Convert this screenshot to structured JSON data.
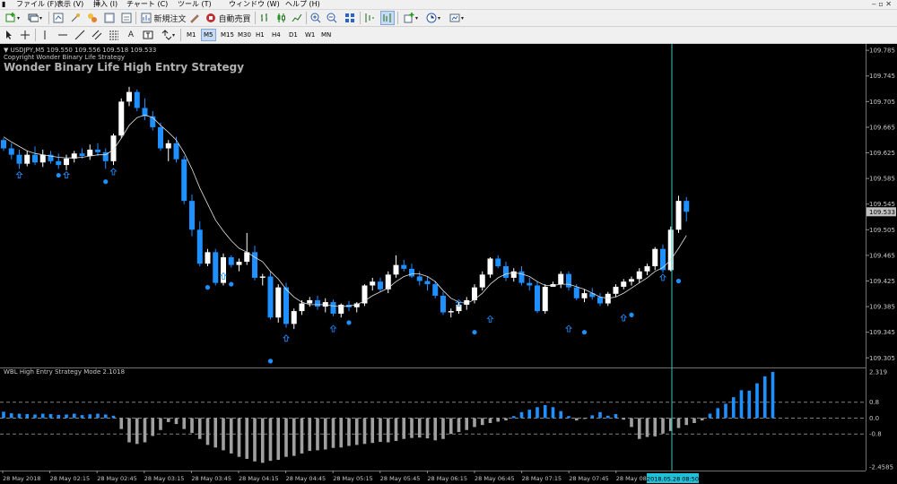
{
  "menu": {
    "items": [
      "ファイル (F)",
      "表示 (V)",
      "挿入 (I)",
      "チャート (C)",
      "ツール (T)",
      "ウィンドウ (W)",
      "ヘルプ (H)"
    ]
  },
  "toolbar": {
    "new_order_label": "新規注文",
    "auto_trade_label": "自動売買"
  },
  "timeframes": [
    "M1",
    "M5",
    "M15",
    "M30",
    "H1",
    "H4",
    "D1",
    "W1",
    "MN"
  ],
  "active_timeframe": "M5",
  "chart": {
    "symbol_line": "▼ USDJPY,M5  109.550 109.556 109.518 109.533",
    "copyright": "Copyright Wonder Binary Life Strategy",
    "strategy_title": "Wonder Binary Life High Entry Strategy",
    "current_price": "109.533",
    "crosshair_time": "2018.05.28 08:50",
    "price_ticks": [
      "109.785",
      "109.745",
      "109.705",
      "109.665",
      "109.625",
      "109.585",
      "109.545",
      "109.505",
      "109.465",
      "109.425",
      "109.385",
      "109.345",
      "109.305"
    ],
    "time_ticks": [
      "28 May 2018",
      "28 May 02:15",
      "28 May 02:45",
      "28 May 03:15",
      "28 May 03:45",
      "28 May 04:15",
      "28 May 04:45",
      "28 May 05:15",
      "28 May 05:45",
      "28 May 06:15",
      "28 May 06:45",
      "28 May 07:15",
      "28 May 07:45",
      "28 May 08:"
    ],
    "indicator_title": "WBL High Entry Strategy Mode 2.1018",
    "indicator_ticks": [
      "2.319",
      "0.8",
      "0.0",
      "-0.8",
      "-2.4585"
    ],
    "colors": {
      "bull": "#ffffff",
      "bear": "#1e90ff",
      "hist_pos": "#1e90ff",
      "hist_neg": "#a0a0a0",
      "crosshair": "#40c0c0",
      "background": "#000000"
    },
    "candles": [
      [
        109.645,
        109.648,
        109.628,
        109.632
      ],
      [
        109.632,
        109.64,
        109.615,
        109.622
      ],
      [
        109.622,
        109.63,
        109.6,
        109.608
      ],
      [
        109.608,
        109.628,
        109.604,
        109.622
      ],
      [
        109.622,
        109.635,
        109.606,
        109.61
      ],
      [
        109.61,
        109.63,
        109.603,
        109.622
      ],
      [
        109.622,
        109.628,
        109.608,
        109.612
      ],
      [
        109.612,
        109.624,
        109.6,
        109.606
      ],
      [
        109.606,
        109.622,
        109.598,
        109.616
      ],
      [
        109.616,
        109.628,
        109.61,
        109.624
      ],
      [
        109.624,
        109.632,
        109.616,
        109.62
      ],
      [
        109.62,
        109.638,
        109.614,
        109.63
      ],
      [
        109.63,
        109.64,
        109.62,
        109.626
      ],
      [
        109.626,
        109.632,
        109.6,
        109.612
      ],
      [
        109.612,
        109.655,
        109.606,
        109.652
      ],
      [
        109.652,
        109.71,
        109.648,
        109.705
      ],
      [
        109.705,
        109.728,
        109.698,
        109.72
      ],
      [
        109.72,
        109.724,
        109.69,
        109.695
      ],
      [
        109.695,
        109.71,
        109.676,
        109.682
      ],
      [
        109.682,
        109.69,
        109.66,
        109.665
      ],
      [
        109.665,
        109.672,
        109.628,
        109.632
      ],
      [
        109.632,
        109.645,
        109.612,
        109.64
      ],
      [
        109.64,
        109.65,
        109.61,
        109.615
      ],
      [
        109.615,
        109.62,
        109.545,
        109.55
      ],
      [
        109.55,
        109.56,
        109.495,
        109.505
      ],
      [
        109.505,
        109.518,
        109.448,
        109.452
      ],
      [
        109.452,
        109.475,
        109.448,
        109.47
      ],
      [
        109.47,
        109.475,
        109.418,
        109.422
      ],
      [
        109.422,
        109.468,
        109.418,
        109.462
      ],
      [
        109.462,
        109.465,
        109.446,
        109.45
      ],
      [
        109.45,
        109.46,
        109.44,
        109.455
      ],
      [
        109.455,
        109.5,
        109.45,
        109.47
      ],
      [
        109.47,
        109.48,
        109.426,
        109.43
      ],
      [
        109.43,
        109.436,
        109.418,
        109.432
      ],
      [
        109.432,
        109.44,
        109.365,
        109.368
      ],
      [
        109.368,
        109.42,
        109.36,
        109.415
      ],
      [
        109.415,
        109.422,
        109.352,
        109.358
      ],
      [
        109.358,
        109.382,
        109.35,
        109.378
      ],
      [
        109.378,
        109.395,
        109.372,
        109.39
      ],
      [
        109.39,
        109.4,
        109.385,
        109.395
      ],
      [
        109.395,
        109.402,
        109.38,
        109.385
      ],
      [
        109.385,
        109.398,
        109.376,
        109.392
      ],
      [
        109.392,
        109.396,
        109.37,
        109.374
      ],
      [
        109.374,
        109.39,
        109.368,
        109.388
      ],
      [
        109.388,
        109.394,
        109.378,
        109.384
      ],
      [
        109.384,
        109.392,
        109.376,
        109.39
      ],
      [
        109.39,
        109.42,
        109.386,
        109.418
      ],
      [
        109.418,
        109.43,
        109.41,
        109.424
      ],
      [
        109.424,
        109.43,
        109.408,
        109.412
      ],
      [
        109.412,
        109.44,
        109.406,
        109.435
      ],
      [
        109.435,
        109.465,
        109.43,
        109.45
      ],
      [
        109.45,
        109.458,
        109.44,
        109.444
      ],
      [
        109.444,
        109.452,
        109.43,
        109.432
      ],
      [
        109.432,
        109.44,
        109.418,
        109.425
      ],
      [
        109.425,
        109.432,
        109.41,
        109.42
      ],
      [
        109.42,
        109.425,
        109.398,
        109.402
      ],
      [
        109.402,
        109.408,
        109.372,
        109.376
      ],
      [
        109.376,
        109.382,
        109.368,
        109.378
      ],
      [
        109.378,
        109.392,
        109.374,
        109.388
      ],
      [
        109.388,
        109.4,
        109.38,
        109.395
      ],
      [
        109.395,
        109.42,
        109.39,
        109.415
      ],
      [
        109.415,
        109.44,
        109.41,
        109.435
      ],
      [
        109.435,
        109.462,
        109.43,
        109.46
      ],
      [
        109.46,
        109.465,
        109.445,
        109.448
      ],
      [
        109.448,
        109.455,
        109.425,
        109.43
      ],
      [
        109.43,
        109.445,
        109.424,
        109.44
      ],
      [
        109.44,
        109.448,
        109.418,
        109.422
      ],
      [
        109.422,
        109.43,
        109.41,
        109.418
      ],
      [
        109.418,
        109.424,
        109.375,
        109.378
      ],
      [
        109.378,
        109.42,
        109.374,
        109.416
      ],
      [
        109.416,
        109.424,
        109.418,
        109.42
      ],
      [
        109.42,
        109.44,
        109.414,
        109.436
      ],
      [
        109.436,
        109.44,
        109.41,
        109.415
      ],
      [
        109.415,
        109.42,
        109.395,
        109.398
      ],
      [
        109.398,
        109.412,
        109.392,
        109.406
      ],
      [
        109.406,
        109.414,
        109.396,
        109.4
      ],
      [
        109.4,
        109.406,
        109.386,
        109.39
      ],
      [
        109.39,
        109.408,
        109.386,
        109.405
      ],
      [
        109.405,
        109.42,
        109.4,
        109.416
      ],
      [
        109.416,
        109.428,
        109.412,
        109.424
      ],
      [
        109.424,
        109.432,
        109.418,
        109.428
      ],
      [
        109.428,
        109.445,
        109.422,
        109.44
      ],
      [
        109.44,
        109.452,
        109.434,
        109.448
      ],
      [
        109.448,
        109.478,
        109.442,
        109.475
      ],
      [
        109.475,
        109.482,
        109.438,
        109.442
      ],
      [
        109.442,
        109.51,
        109.44,
        109.505
      ],
      [
        109.505,
        109.558,
        109.5,
        109.55
      ],
      [
        109.55,
        109.556,
        109.518,
        109.533
      ]
    ],
    "histogram": [
      0.32,
      0.24,
      0.22,
      0.2,
      0.18,
      0.22,
      0.2,
      0.16,
      0.18,
      0.22,
      0.15,
      0.19,
      0.22,
      0.18,
      0.12,
      -0.55,
      -1.22,
      -1.3,
      -1.22,
      -0.9,
      -0.6,
      -0.2,
      -0.3,
      -0.55,
      -0.75,
      -1.05,
      -1.35,
      -1.48,
      -1.62,
      -1.78,
      -1.95,
      -2.05,
      -2.18,
      -2.25,
      -2.15,
      -2.1,
      -1.95,
      -1.9,
      -1.78,
      -1.65,
      -1.62,
      -1.58,
      -1.5,
      -1.48,
      -1.4,
      -1.35,
      -1.3,
      -1.25,
      -1.2,
      -1.22,
      -1.15,
      -1.05,
      -1.0,
      -0.98,
      -1.02,
      -1.12,
      -1.05,
      -0.8,
      -0.7,
      -0.6,
      -0.45,
      -0.35,
      -0.25,
      -0.18,
      -0.12,
      0.1,
      0.3,
      0.42,
      0.55,
      0.65,
      0.55,
      0.35,
      0.1,
      -0.12,
      -0.04,
      0.14,
      0.3,
      0.12,
      0.2,
      -0.08,
      -0.45,
      -1.05,
      -0.95,
      -0.92,
      -0.78,
      -0.65,
      -0.5,
      -0.35,
      -0.25,
      -0.12,
      0.22,
      0.5,
      0.72,
      1.05,
      1.4,
      1.38,
      1.75,
      2.1,
      2.319
    ],
    "ma": [
      109.65,
      109.642,
      109.635,
      109.628,
      109.624,
      109.622,
      109.62,
      109.618,
      109.617,
      109.617,
      109.618,
      109.62,
      109.622,
      109.622,
      109.63,
      109.648,
      109.668,
      109.68,
      109.684,
      109.68,
      109.668,
      109.657,
      109.645,
      109.625,
      109.6,
      109.57,
      109.545,
      109.52,
      109.503,
      109.488,
      109.476,
      109.47,
      109.462,
      109.455,
      109.44,
      109.428,
      109.412,
      109.4,
      109.392,
      109.388,
      109.388,
      109.388,
      109.386,
      109.385,
      109.386,
      109.388,
      109.394,
      109.402,
      109.408,
      109.414,
      109.424,
      109.432,
      109.436,
      109.436,
      109.432,
      109.424,
      109.41,
      109.398,
      109.392,
      109.39,
      109.396,
      109.406,
      109.42,
      109.43,
      109.436,
      109.438,
      109.436,
      109.432,
      109.424,
      109.418,
      109.418,
      109.42,
      109.42,
      109.416,
      109.412,
      109.406,
      109.4,
      109.398,
      109.4,
      109.406,
      109.414,
      109.422,
      109.43,
      109.44,
      109.446,
      109.458,
      109.476,
      109.496
    ],
    "markers": [
      {
        "index": 2,
        "type": "arrow",
        "price": 109.59
      },
      {
        "index": 7,
        "type": "dot",
        "price": 109.59
      },
      {
        "index": 8,
        "type": "arrow",
        "price": 109.59
      },
      {
        "index": 13,
        "type": "dot",
        "price": 109.58
      },
      {
        "index": 14,
        "type": "arrow",
        "price": 109.595
      },
      {
        "index": 26,
        "type": "dot",
        "price": 109.415
      },
      {
        "index": 28,
        "type": "arrow",
        "price": 109.432
      },
      {
        "index": 29,
        "type": "dot",
        "price": 109.42
      },
      {
        "index": 34,
        "type": "dot",
        "price": 109.3
      },
      {
        "index": 36,
        "type": "arrow",
        "price": 109.335
      },
      {
        "index": 42,
        "type": "arrow",
        "price": 109.35
      },
      {
        "index": 44,
        "type": "dot",
        "price": 109.36
      },
      {
        "index": 58,
        "type": "arrow",
        "price": 109.39
      },
      {
        "index": 60,
        "type": "dot",
        "price": 109.345
      },
      {
        "index": 62,
        "type": "arrow",
        "price": 109.365
      },
      {
        "index": 72,
        "type": "arrow",
        "price": 109.35
      },
      {
        "index": 74,
        "type": "dot",
        "price": 109.345
      },
      {
        "index": 79,
        "type": "arrow",
        "price": 109.367
      },
      {
        "index": 80,
        "type": "dot",
        "price": 109.372
      },
      {
        "index": 84,
        "type": "arrow",
        "price": 109.43
      },
      {
        "index": 86,
        "type": "dot",
        "price": 109.425
      }
    ]
  }
}
